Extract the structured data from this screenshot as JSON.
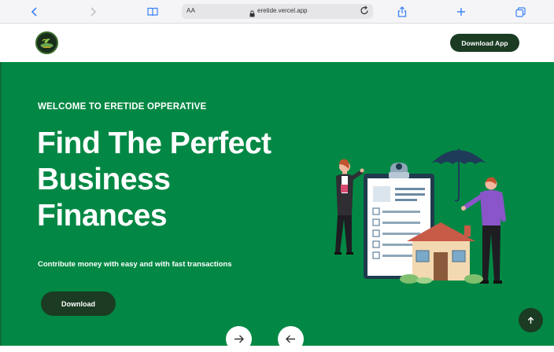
{
  "browser": {
    "address_prefix": "AA",
    "url": "eretide.vercel.app",
    "icons": [
      "back-icon",
      "forward-icon",
      "book-icon",
      "lock-icon",
      "reload-icon",
      "share-icon",
      "plus-icon",
      "tabs-icon"
    ]
  },
  "header": {
    "download_app_label": "Download App"
  },
  "hero": {
    "welcome": "WELCOME TO ERETIDE OPPERATIVE",
    "headline": [
      "Find The Perfect",
      "Business",
      "Finances"
    ],
    "subtext": "Contribute money with easy and with fast transactions",
    "download_label": "Download"
  },
  "colors": {
    "hero_green": "#028844",
    "dark_green": "#1b3b23",
    "white": "#ffffff"
  }
}
